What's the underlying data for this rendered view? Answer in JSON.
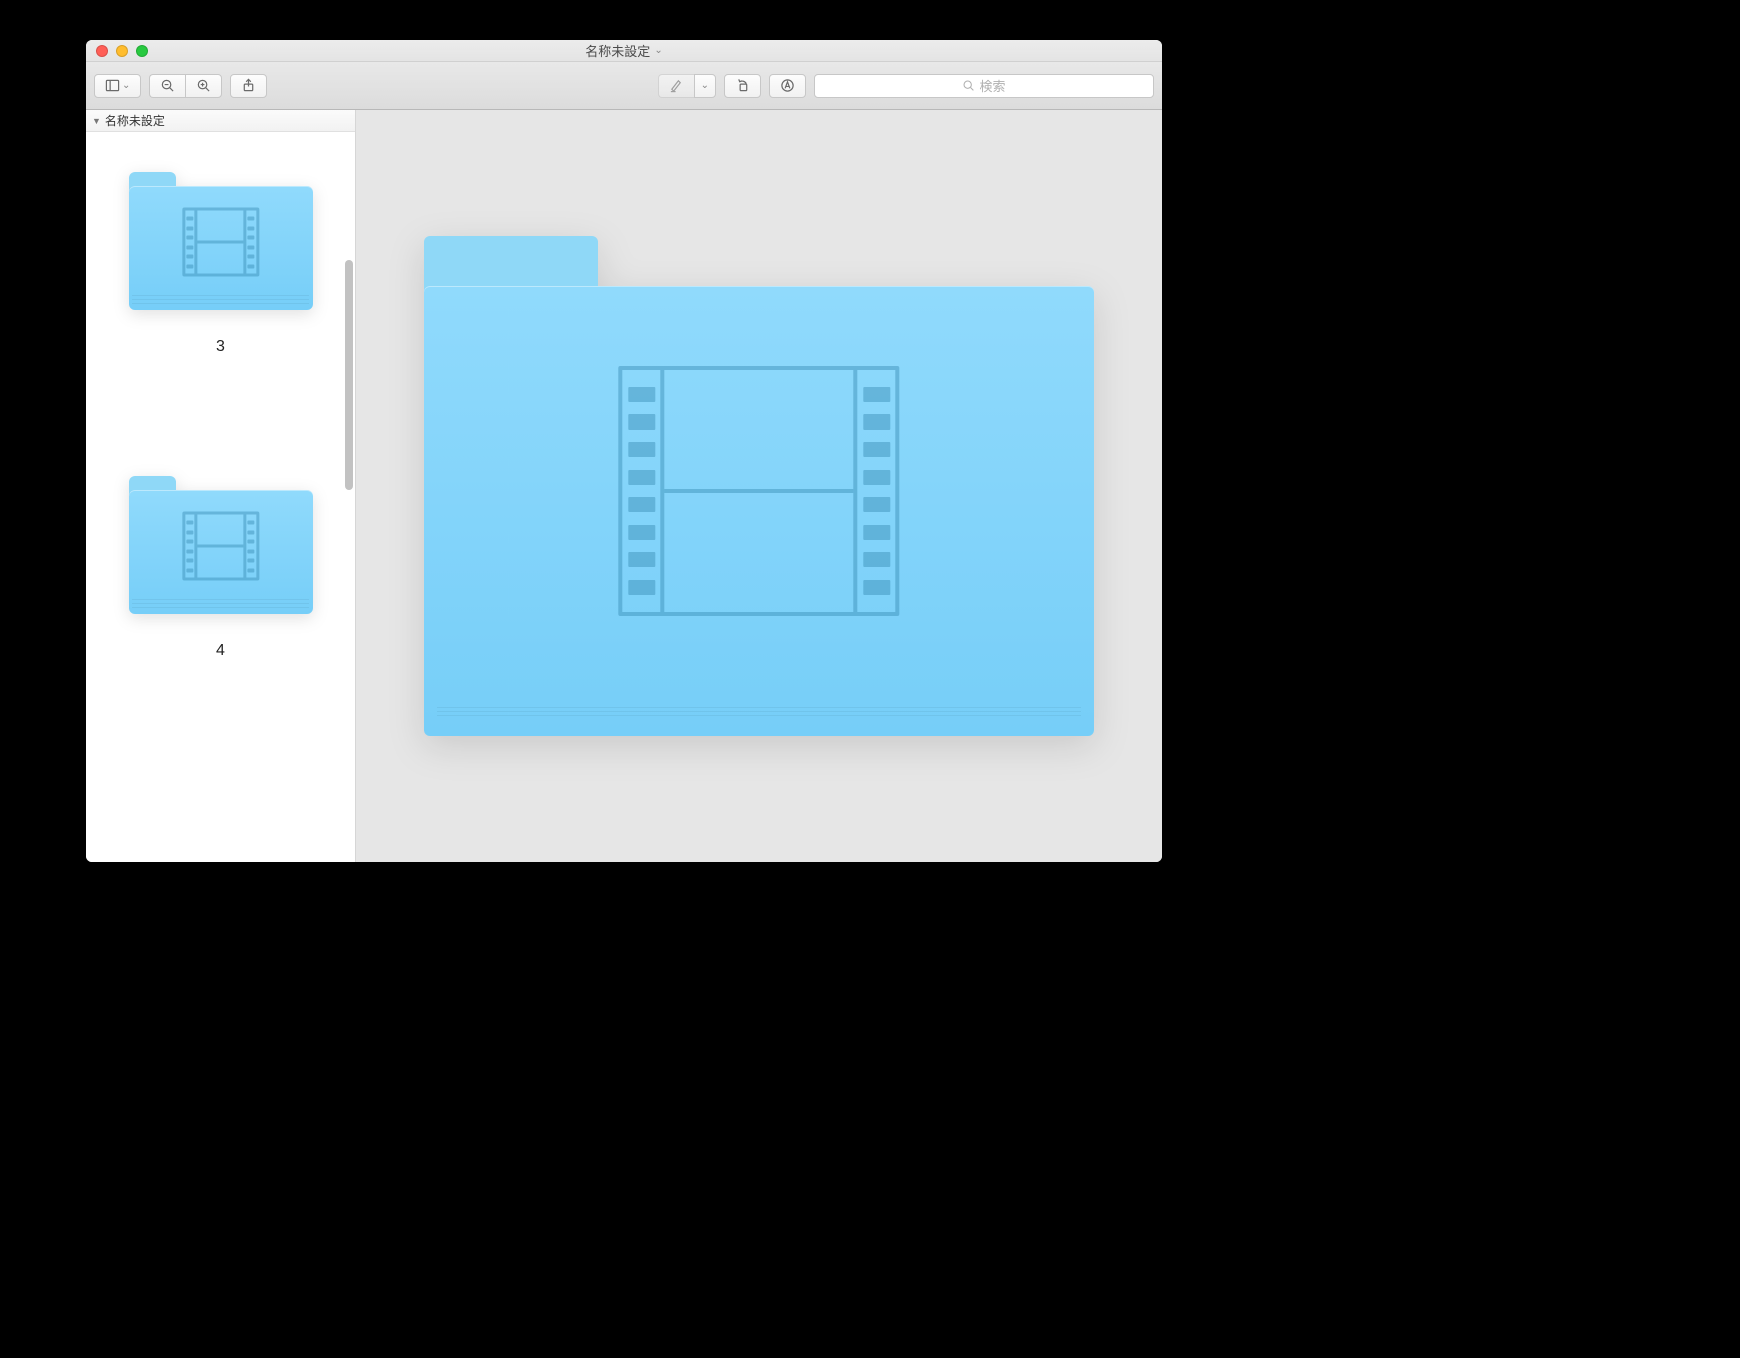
{
  "window": {
    "title": "名称未設定"
  },
  "toolbar": {
    "search_placeholder": "検索"
  },
  "sidebar": {
    "header": "名称未設定",
    "thumbs": [
      {
        "label": "3"
      },
      {
        "label": "4"
      }
    ]
  }
}
